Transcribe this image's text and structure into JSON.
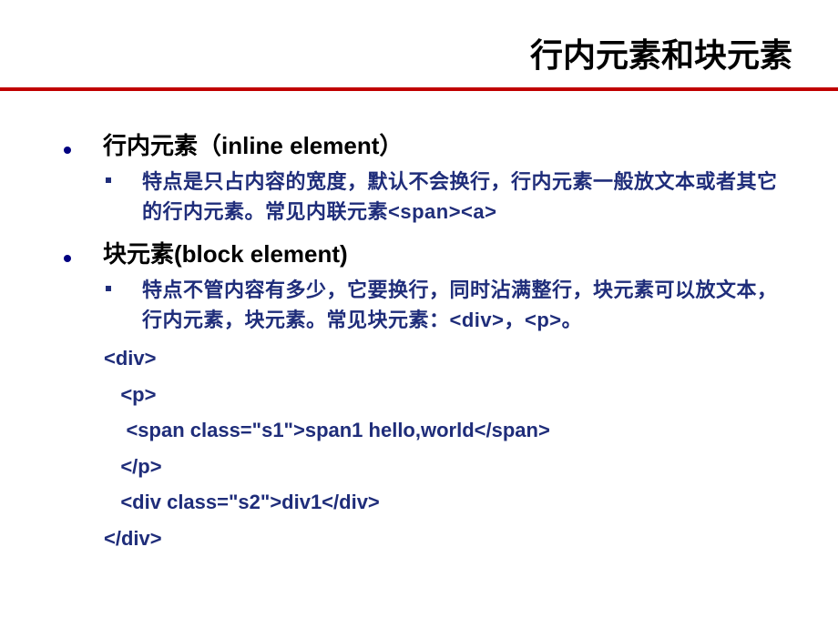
{
  "title": "行内元素和块元素",
  "section1": {
    "heading": "行内元素（inline element）",
    "body": "特点是只占内容的宽度，默认不会换行，行内元素一般放文本或者其它的行内元素。常见内联元素<span><a>"
  },
  "section2": {
    "heading": "块元素(block element)",
    "body": "特点不管内容有多少，它要换行，同时沾满整行，块元素可以放文本，行内元素，块元素。常见块元素：<div>，<p>。"
  },
  "code": {
    "l1": "<div>",
    "l2": "   <p>",
    "l3": "    <span class=\"s1\">span1 hello,world</span>",
    "l4": "   </p>",
    "l5": "   <div class=\"s2\">div1</div>",
    "l6": "</div>"
  }
}
